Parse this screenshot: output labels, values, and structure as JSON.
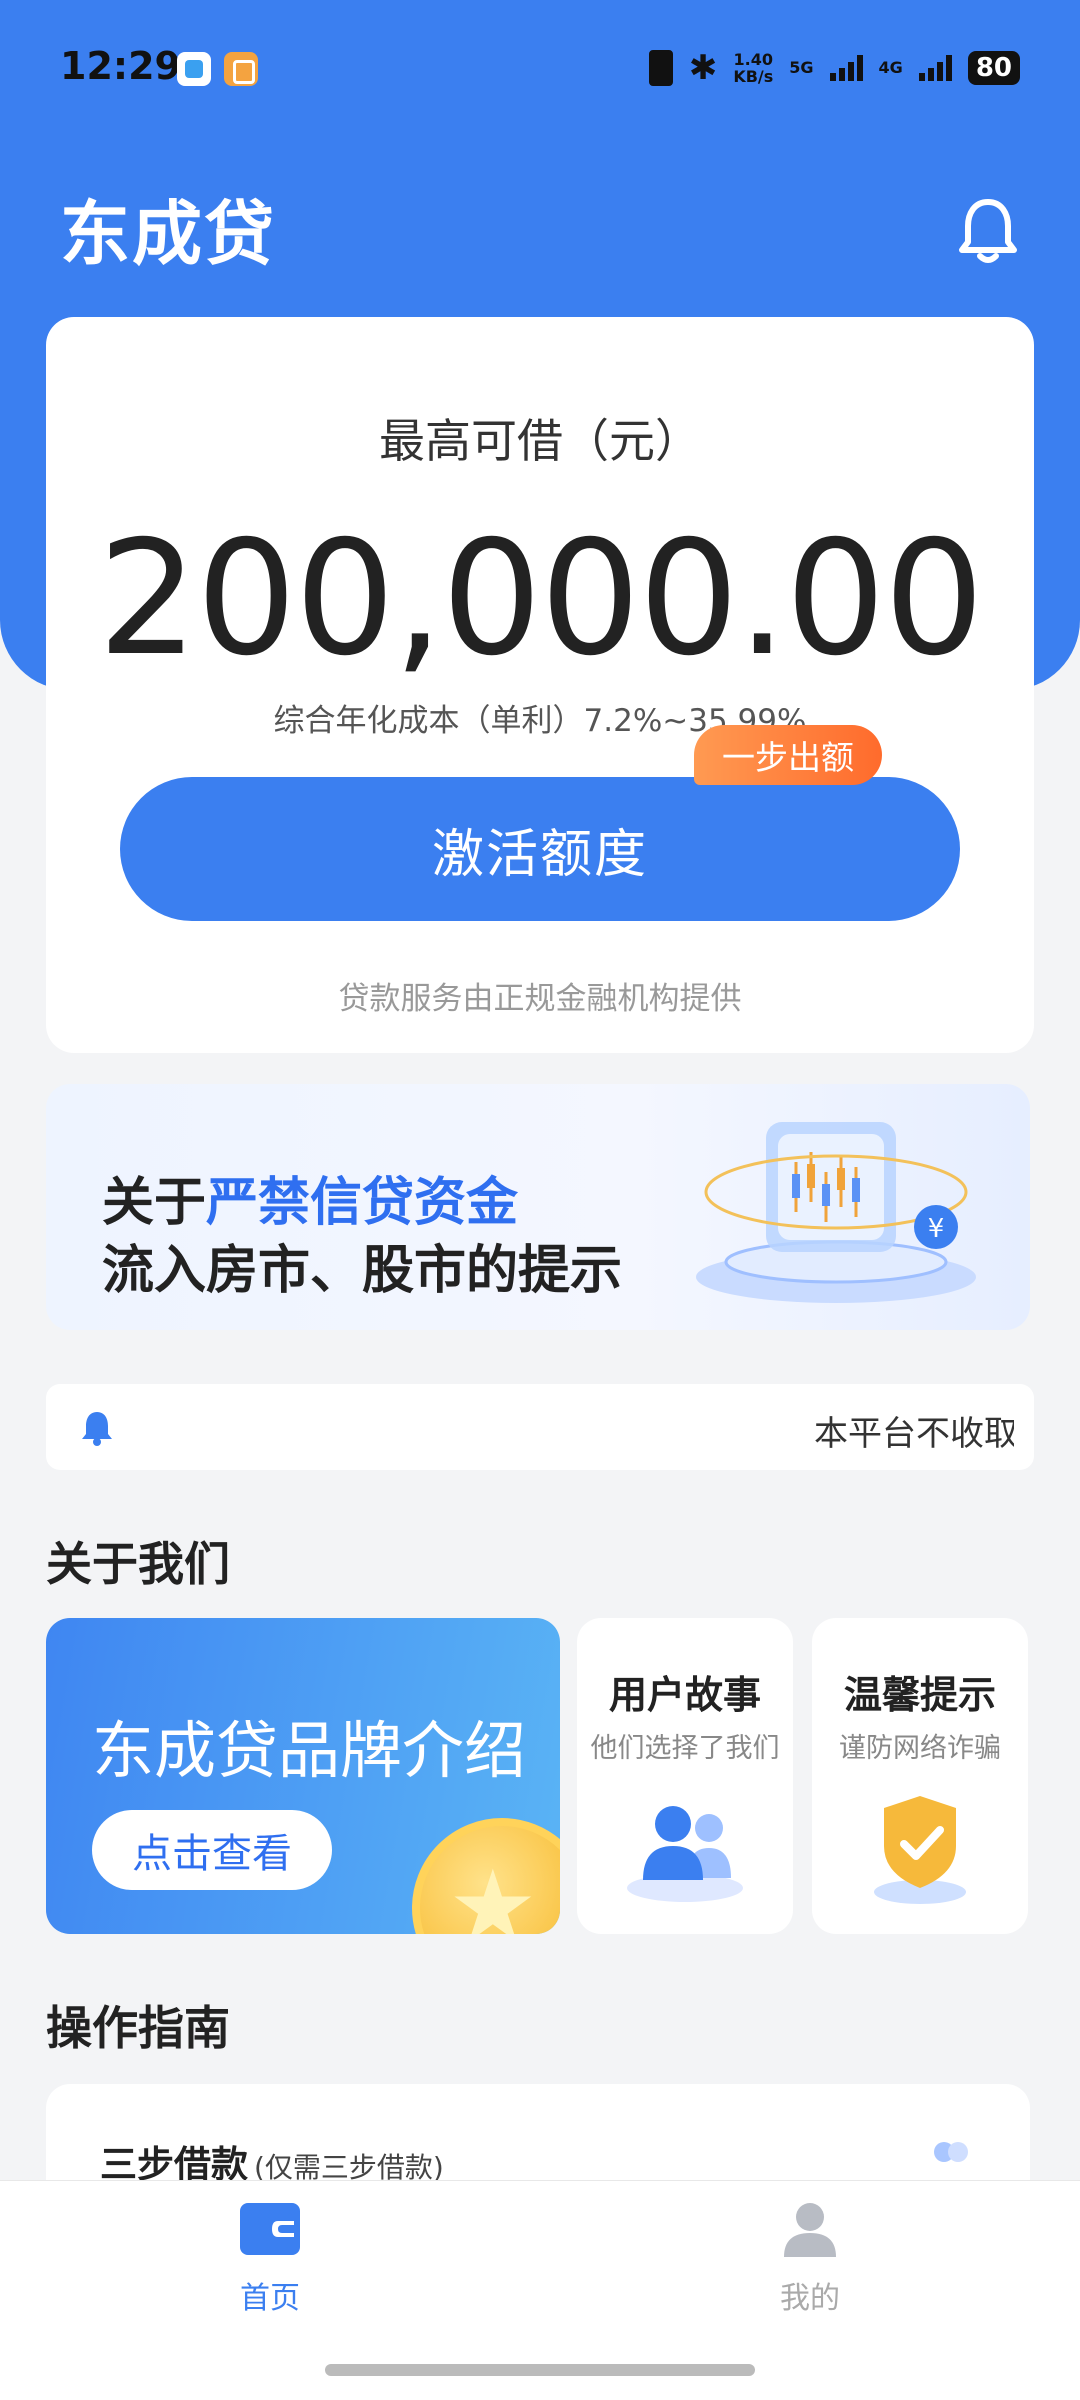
{
  "status_bar": {
    "time": "12:29",
    "net_speed_value": "1.40",
    "net_speed_unit": "KB/s",
    "net1": "5G",
    "net2": "4G",
    "battery": "80"
  },
  "header": {
    "app_title": "东成贷"
  },
  "loan_card": {
    "label": "最高可借（元）",
    "amount": "200,000.00",
    "rate_text": "综合年化成本（单利）7.2%~35.99%",
    "badge": "一步出额",
    "activate_label": "激活额度",
    "footer_text": "贷款服务由正规金融机构提供"
  },
  "banner": {
    "line1_prefix": "关于",
    "line1_highlight": "严禁信贷资金",
    "line2": "流入房市、股市的提示"
  },
  "notice": {
    "text": "本平台不收取"
  },
  "about": {
    "title": "关于我们",
    "brand_title": "东成贷品牌介绍",
    "brand_button": "点击查看",
    "story_title": "用户故事",
    "story_sub": "他们选择了我们",
    "tips_title": "温馨提示",
    "tips_sub": "谨防网络诈骗"
  },
  "guide": {
    "title": "操作指南",
    "item_title": "三步借款",
    "item_sub": "(仅需三步借款)"
  },
  "tabbar": {
    "home": "首页",
    "mine": "我的"
  },
  "colors": {
    "primary": "#3b7ff0",
    "badge_orange": "#ff7a35",
    "background": "#f3f4f6"
  }
}
